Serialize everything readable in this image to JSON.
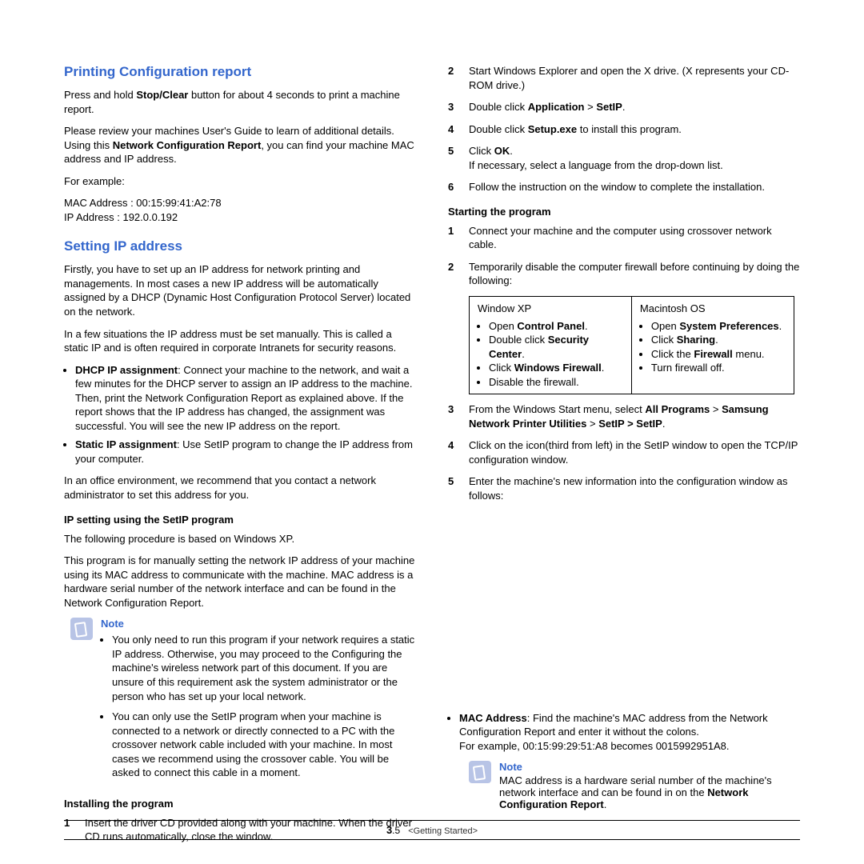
{
  "left": {
    "h1": "Printing Configuration report",
    "p1a": "Press and hold ",
    "p1b": "Stop/Clear",
    "p1c": " button for about 4 seconds to print a machine report.",
    "p2a": "Please review your machines User's Guide to learn of additional details. Using this ",
    "p2b": "Network Configuration Report",
    "p2c": ", you can find your machine MAC address and IP address.",
    "forex": "For example:",
    "mac": "MAC Address    : 00:15:99:41:A2:78",
    "ip": "IP Address        : 192.0.0.192",
    "h2": "Setting IP address",
    "p3": "Firstly, you have to set up an IP address for network printing and managements. In most cases a new IP address will be automatically assigned by a DHCP (Dynamic Host Configuration Protocol Server) located on the network.",
    "p4": "In a few situations the IP address must be set manually.  This is called a static IP and is often required in corporate Intranets for security reasons.",
    "b1a": "DHCP IP assignment",
    "b1b": ":  Connect your machine to the network, and wait a few minutes for the DHCP server to assign an IP address to the machine. Then, print the Network Configuration Report as explained above. If the report shows that the IP address has changed, the assignment was successful. You will see the new IP address on the report.",
    "b2a": "Static IP assignment",
    "b2b": ": Use SetIP program to change the IP address from your computer.",
    "p5": "In an office environment, we recommend that you contact a network administrator to set this address for you.",
    "h3": "IP setting using the SetIP program",
    "p6": "The following procedure is based on Windows XP.",
    "p7": "This program is for manually setting the network IP address of your machine using its MAC address to communicate with the machine. MAC address is a hardware serial number of the network interface and can be found in the Network Configuration Report.",
    "note1_label": "Note",
    "note1_b1": "You only need to run this program if your network requires a static IP address. Otherwise, you may proceed to the Configuring the machine's wireless network part of this document. If you are unsure of this requirement ask the system administrator or the person who has set up your local network.",
    "note1_b2": "You can only use the SetIP program when your machine is connected to a network or directly connected to a PC with the crossover network cable included with your machine.  In most cases we recommend using the crossover cable. You will be asked to connect this cable in a moment.",
    "h4": "Installing the program",
    "s1_num": "1",
    "s1": "Insert the driver CD provided along with your machine. When the driver CD runs automatically, close the window."
  },
  "right": {
    "s2_num": "2",
    "s2": "Start Windows Explorer and open the X drive. (X represents your CD-ROM drive.)",
    "s3_num": "3",
    "s3a": "Double click ",
    "s3b": "Application",
    "s3c": " > ",
    "s3d": "SetIP",
    "s3e": ".",
    "s4_num": "4",
    "s4a": "Double click ",
    "s4b": "Setup.exe",
    "s4c": " to install this program.",
    "s5_num": "5",
    "s5a": "Click ",
    "s5b": "OK",
    "s5c": ".",
    "s5d": "If necessary, select a language from the drop-down list.",
    "s6_num": "6",
    "s6": "Follow the instruction on the window to complete the installation.",
    "h5": "Starting the program",
    "t1_num": "1",
    "t1": "Connect your machine and the computer using crossover network cable.",
    "t2_num": "2",
    "t2": "Temporarily disable the computer firewall before continuing by doing the following:",
    "tbl": {
      "c1_head": "Window XP",
      "c1_b1a": "Open ",
      "c1_b1b": "Control Panel",
      "c1_b1c": ".",
      "c1_b2a": "Double click ",
      "c1_b2b": "Security Center",
      "c1_b2c": ".",
      "c1_b3a": "Click ",
      "c1_b3b": "Windows Firewall",
      "c1_b3c": ".",
      "c1_b4": "Disable the firewall.",
      "c2_head": "Macintosh OS",
      "c2_b1a": "Open ",
      "c2_b1b": "System Preferences",
      "c2_b1c": ".",
      "c2_b2a": "Click ",
      "c2_b2b": "Sharing",
      "c2_b2c": ".",
      "c2_b3a": "Click the ",
      "c2_b3b": "Firewall",
      "c2_b3c": " menu.",
      "c2_b4": "Turn firewall off."
    },
    "t3_num": "3",
    "t3a": "From the Windows Start menu, select ",
    "t3b": "All Programs",
    "t3c": " > ",
    "t3d": "Samsung Network Printer Utilities",
    "t3e": " > ",
    "t3f": "SetIP > SetIP",
    "t3g": ".",
    "t4_num": "4",
    "t4": "Click on  the           icon(third from left) in the SetIP window to open the TCP/IP configuration window.",
    "t5_num": "5",
    "t5": "Enter the machine's new information into the configuration window as follows:",
    "mac1a": "MAC Address",
    "mac1b": ": Find the machine's MAC address from the Network Configuration Report and enter it without the colons.",
    "mac1c": "For example, 00:15:99:29:51:A8 becomes 0015992951A8.",
    "note2_label": "Note",
    "note2a": " MAC address is a hardware serial number of the machine's network interface and can be found in on the ",
    "note2b": "Network Configuration Report",
    "note2c": "."
  },
  "footer": {
    "page_major": "3",
    "page_minor": ".5",
    "section": "<Getting Started>"
  }
}
